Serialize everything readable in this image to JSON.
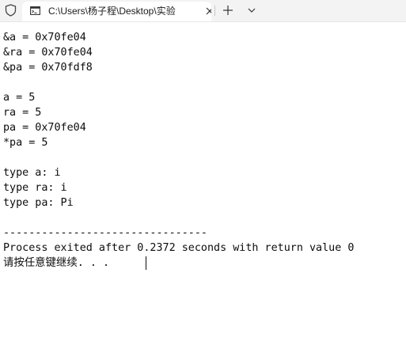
{
  "window": {
    "tab_title": "C:\\Users\\杨子程\\Desktop\\实验",
    "new_tab_label": "+",
    "dropdown_label": "⌄"
  },
  "terminal": {
    "lines": [
      "&a = 0x70fe04",
      "&ra = 0x70fe04",
      "&pa = 0x70fdf8",
      "",
      "a = 5",
      "ra = 5",
      "pa = 0x70fe04",
      "*pa = 5",
      "",
      "type a: i",
      "type ra: i",
      "type pa: Pi",
      "",
      "--------------------------------",
      "Process exited after 0.2372 seconds with return value 0",
      "请按任意键继续. . ."
    ]
  },
  "icons": {
    "shield": "shield-icon",
    "app": "console-app-icon",
    "close": "close-icon",
    "new_tab": "plus-icon",
    "dropdown": "chevron-down-icon"
  }
}
